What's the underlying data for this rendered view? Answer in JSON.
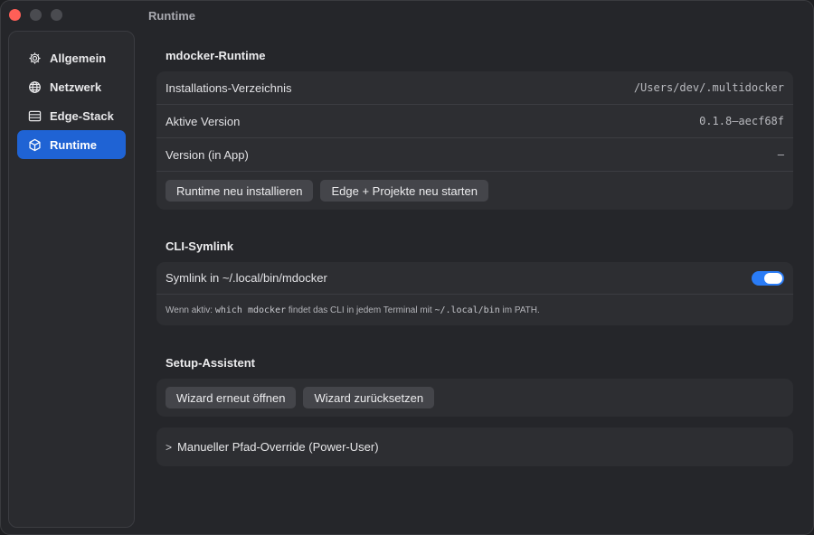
{
  "window": {
    "title": "Runtime"
  },
  "sidebar": {
    "items": [
      {
        "label": "Allgemein",
        "icon": "gear-icon"
      },
      {
        "label": "Netzwerk",
        "icon": "globe-icon"
      },
      {
        "label": "Edge-Stack",
        "icon": "server-icon"
      },
      {
        "label": "Runtime",
        "icon": "cube-icon",
        "active": true
      }
    ]
  },
  "runtime_section": {
    "title": "mdocker-Runtime",
    "rows": [
      {
        "label": "Installations-Verzeichnis",
        "value": "/Users/dev/.multidocker"
      },
      {
        "label": "Aktive Version",
        "value": "0.1.8–aecf68f"
      },
      {
        "label": "Version (in App)",
        "value": "–"
      }
    ],
    "reinstall_label": "Runtime neu installieren",
    "restart_label": "Edge + Projekte neu starten"
  },
  "symlink_section": {
    "title": "CLI-Symlink",
    "toggle_label": "Symlink in ~/.local/bin/mdocker",
    "toggle_on": true,
    "hint_prefix": "Wenn aktiv:",
    "hint_code1": "which mdocker",
    "hint_middle": "findet das CLI in jedem Terminal mit",
    "hint_code2": "~/.local/bin",
    "hint_suffix": "im PATH."
  },
  "setup_section": {
    "title": "Setup-Assistent",
    "reopen_label": "Wizard erneut öffnen",
    "reset_label": "Wizard zurücksetzen"
  },
  "override_section": {
    "label": "Manueller Pfad-Override (Power-User)"
  },
  "colors": {
    "accent": "#1f63d4",
    "toggle": "#2a7cf6",
    "close": "#ff5f57"
  }
}
